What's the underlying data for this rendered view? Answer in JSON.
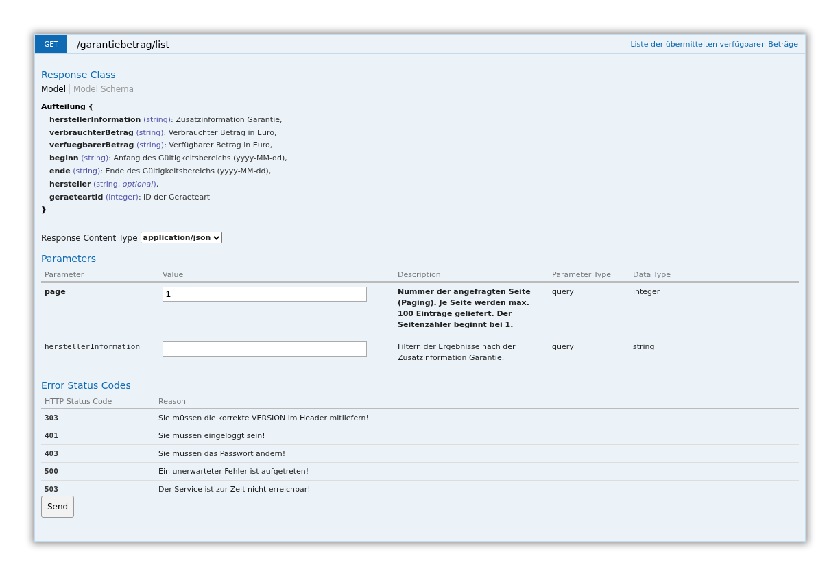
{
  "operation": {
    "method": "GET",
    "path": "/garantiebetrag/list",
    "summary": "Liste der übermittelten verfügbaren Beträge"
  },
  "response_class": {
    "title": "Response Class",
    "tabs": [
      {
        "label": "Model",
        "selected": true
      },
      {
        "label": "Model Schema",
        "selected": false
      }
    ],
    "model": {
      "open": "Aufteilung {",
      "close": "}",
      "properties": [
        {
          "name": "herstellerInformation",
          "type": "(string)",
          "text": ": Zusatzinformation Garantie,"
        },
        {
          "name": "verbrauchterBetrag",
          "type": "(string)",
          "text": ": Verbrauchter Betrag in Euro,"
        },
        {
          "name": "verfuegbarerBetrag",
          "type": "(string)",
          "text": ": Verfügbarer Betrag in Euro,"
        },
        {
          "name": "beginn",
          "type": "(string)",
          "text": ": Anfang des Gültigkeitsbereichs (yyyy-MM-dd),"
        },
        {
          "name": "ende",
          "type": "(string)",
          "text": ": Ende des Gültigkeitsbereichs (yyyy-MM-dd),"
        },
        {
          "name": "hersteller",
          "type": "(string, *optional*)",
          "text": ","
        },
        {
          "name": "geraeteartId",
          "type": "(integer)",
          "text": ": ID der Geraeteart"
        }
      ]
    }
  },
  "content_type": {
    "label": "Response Content Type",
    "value": "application/json"
  },
  "parameters": {
    "title": "Parameters",
    "columns": [
      "Parameter",
      "Value",
      "Description",
      "Parameter Type",
      "Data Type"
    ],
    "rows": [
      {
        "name": "page",
        "required": true,
        "value": "1",
        "description": "Nummer der angefragten Seite (Paging). Je Seite werden max. 100 Einträge geliefert. Der Seitenzähler beginnt bei 1.",
        "param_type": "query",
        "data_type": "integer"
      },
      {
        "name": "herstellerInformation",
        "required": false,
        "value": "",
        "description": "Filtern der Ergebnisse nach der Zusatzinformation Garantie.",
        "param_type": "query",
        "data_type": "string"
      }
    ]
  },
  "error_codes": {
    "title": "Error Status Codes",
    "columns": [
      "HTTP Status Code",
      "Reason"
    ],
    "rows": [
      {
        "code": "303",
        "reason": "Sie müssen die korrekte VERSION im Header mitliefern!"
      },
      {
        "code": "401",
        "reason": "Sie müssen eingeloggt sein!"
      },
      {
        "code": "403",
        "reason": "Sie müssen das Passwort ändern!"
      },
      {
        "code": "500",
        "reason": "Ein unerwarteter Fehler ist aufgetreten!"
      },
      {
        "code": "503",
        "reason": "Der Service ist zur Zeit nicht erreichbar!"
      }
    ]
  },
  "send_button": "Send"
}
